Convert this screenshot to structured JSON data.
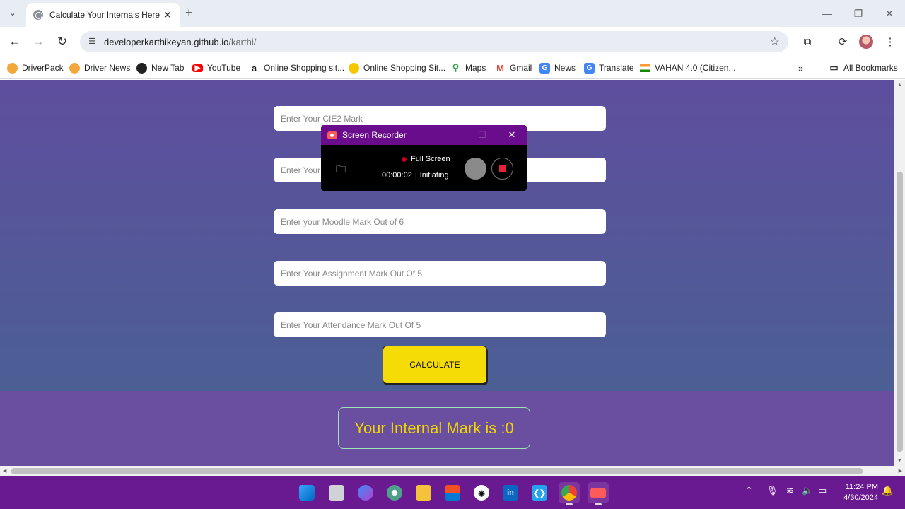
{
  "browser": {
    "tab_title": "Calculate Your Internals Here",
    "tab_close": "✕",
    "new_tab": "+",
    "url_host": "developerkarthikeyan.github.io",
    "url_path": "/karthi/"
  },
  "bookmarks": [
    {
      "label": "DriverPack",
      "icon": "driverpack-icon",
      "color": "#f2a83b"
    },
    {
      "label": "Driver News",
      "icon": "driver-news-icon",
      "color": "#f2a83b"
    },
    {
      "label": "New Tab",
      "icon": "globe-icon",
      "color": "#222222"
    },
    {
      "label": "YouTube",
      "icon": "youtube-icon",
      "color": "#ff0000"
    },
    {
      "label": "Online Shopping sit...",
      "icon": "amazon-icon",
      "color": "#111111"
    },
    {
      "label": "Online Shopping Sit...",
      "icon": "flipkart-icon",
      "color": "#f7c600"
    },
    {
      "label": "Maps",
      "icon": "maps-icon",
      "color": "#34a853"
    },
    {
      "label": "Gmail",
      "icon": "gmail-icon",
      "color": "#ea4335"
    },
    {
      "label": "News",
      "icon": "google-news-icon",
      "color": "#4285f4"
    },
    {
      "label": "Translate",
      "icon": "translate-icon",
      "color": "#4285f4"
    },
    {
      "label": "VAHAN 4.0 (Citizen...",
      "icon": "india-flag-icon",
      "color": "#ff9933"
    }
  ],
  "all_bookmarks": "All Bookmarks",
  "form": {
    "cie2_placeholder": "Enter Your CIE2 Mark",
    "hidden_placeholder": "Enter Your",
    "moodle_placeholder": "Enter your Moodle Mark Out of 6",
    "assignment_placeholder": "Enter Your Assignment Mark Out Of 5",
    "attendance_placeholder": "Enter Your Attendance Mark Out Of 5",
    "calculate_label": "CALCULATE",
    "result_text": "Your Internal Mark is :0"
  },
  "recorder": {
    "title": "Screen Recorder",
    "mode": "Full Screen",
    "time": "00:00:02",
    "status": "Initiating"
  },
  "taskbar": {
    "time": "11:24 PM",
    "date": "4/30/2024"
  },
  "colors": {
    "page_gradient_top": "#5f4e9e",
    "page_gradient_bottom": "#4b5f94",
    "footer": "#6a4ea0",
    "button": "#f5dc07",
    "result_text": "#f2d600",
    "taskbar": "#6a1a91"
  }
}
